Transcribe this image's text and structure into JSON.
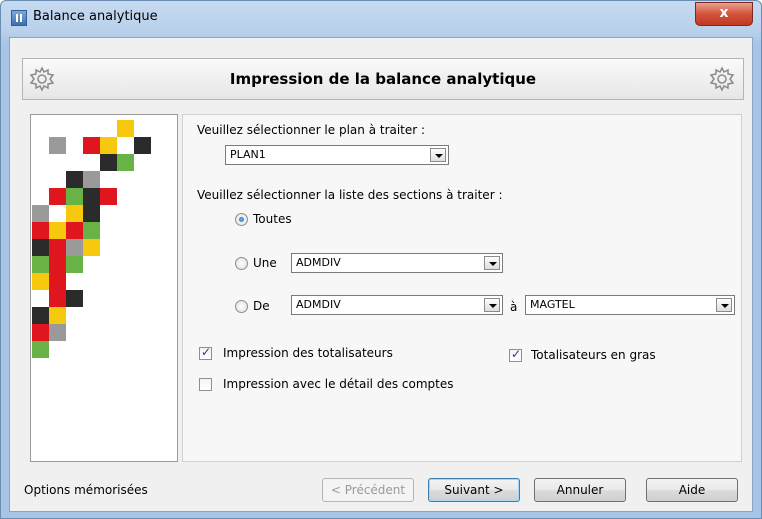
{
  "window": {
    "title": "Balance analytique",
    "close_label": "x"
  },
  "header": {
    "title": "Impression de la balance analytique",
    "left_icon": "gear-icon",
    "right_icon": "gear-icon"
  },
  "plan": {
    "prompt": "Veuillez sélectionner le plan à traiter :",
    "selected": "PLAN1"
  },
  "sections": {
    "prompt": "Veuillez sélectionner la liste des sections à traiter :",
    "option_all": "Toutes",
    "option_one": "Une",
    "option_one_value": "ADMDIV",
    "option_range": "De",
    "range_from": "ADMDIV",
    "range_to_label": "à",
    "range_to": "MAGTEL",
    "selected_option": "Toutes"
  },
  "options": {
    "totals_label": "Impression des totalisateurs",
    "totals_checked": true,
    "bold_totals_label": "Totalisateurs en gras",
    "bold_totals_checked": true,
    "detail_label": "Impression avec le détail des comptes",
    "detail_checked": false
  },
  "footer": {
    "memorized_label": "Options mémorisées",
    "prev_label": "< Précédent",
    "next_label": "Suivant >",
    "cancel_label": "Annuler",
    "help_label": "Aide"
  },
  "colors": {
    "red": "#e0161f",
    "yellow": "#f6c90e",
    "green": "#69b245",
    "dark": "#2b2b2b",
    "gray": "#9a9a9a"
  }
}
